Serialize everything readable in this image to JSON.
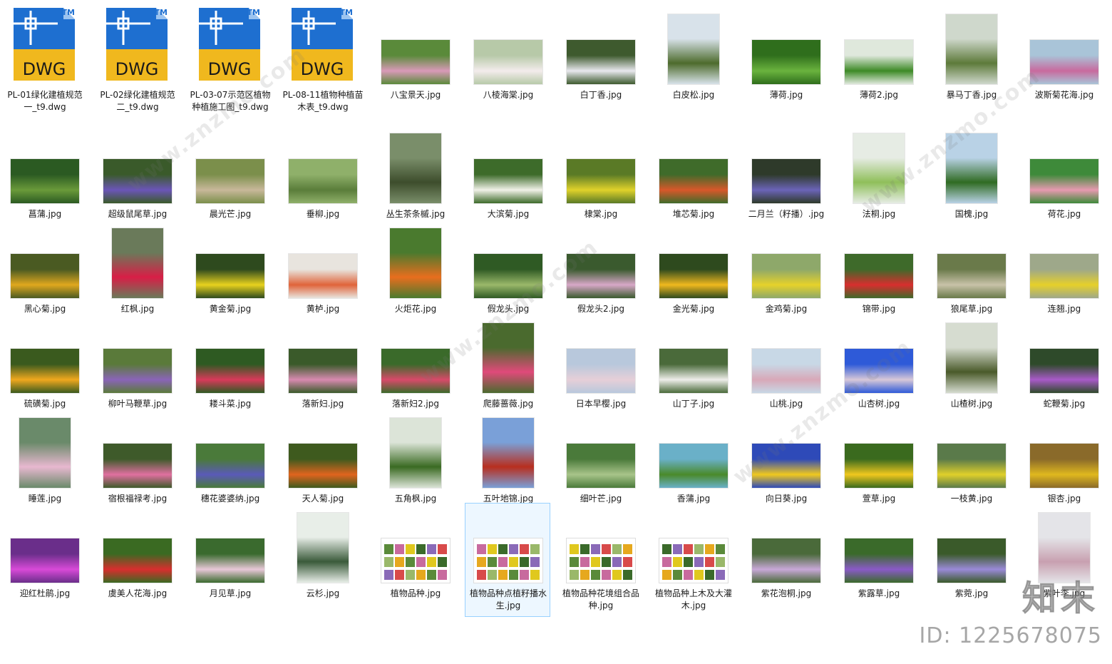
{
  "files": [
    {
      "name": "PL-01绿化建植规范一_t9.dwg",
      "type": "dwg"
    },
    {
      "name": "PL-02绿化建植规范二_t9.dwg",
      "type": "dwg"
    },
    {
      "name": "PL-03-07示范区植物种植施工图_t9.dwg",
      "type": "dwg"
    },
    {
      "name": "PL-08-11植物种植苗木表_t9.dwg",
      "type": "dwg"
    },
    {
      "name": "八宝景天.jpg",
      "type": "photo",
      "colors": [
        "#5a8a3a",
        "#d99ab8"
      ]
    },
    {
      "name": "八棱海棠.jpg",
      "type": "photo",
      "colors": [
        "#b7c9a8",
        "#f3ecec"
      ]
    },
    {
      "name": "白丁香.jpg",
      "type": "photo",
      "colors": [
        "#3e5a2e",
        "#e8e8ee"
      ]
    },
    {
      "name": "白皮松.jpg",
      "type": "tall",
      "colors": [
        "#d8e2ea",
        "#4d6b2c"
      ]
    },
    {
      "name": "薄荷.jpg",
      "type": "photo",
      "colors": [
        "#2f6e1c",
        "#6ab33e"
      ]
    },
    {
      "name": "薄荷2.jpg",
      "type": "photo",
      "colors": [
        "#dfe8dc",
        "#3d8a26"
      ]
    },
    {
      "name": "暴马丁香.jpg",
      "type": "tall",
      "colors": [
        "#cfd8cc",
        "#5d7a3a"
      ]
    },
    {
      "name": "波斯菊花海.jpg",
      "type": "photo",
      "colors": [
        "#a9c4d8",
        "#c86a9e"
      ]
    },
    {
      "name": "菖蒲.jpg",
      "type": "photo",
      "colors": [
        "#2b5a22",
        "#6a9a3a"
      ]
    },
    {
      "name": "超级鼠尾草.jpg",
      "type": "photo",
      "colors": [
        "#3a5a2a",
        "#6b55b8"
      ]
    },
    {
      "name": "晨光芒.jpg",
      "type": "photo",
      "colors": [
        "#7b8f4b",
        "#c8b89a"
      ]
    },
    {
      "name": "垂柳.jpg",
      "type": "photo",
      "colors": [
        "#8fb06a",
        "#5a7d3a"
      ]
    },
    {
      "name": "丛生茶条槭.jpg",
      "type": "tall",
      "colors": [
        "#7a8e6a",
        "#3d4d2c"
      ]
    },
    {
      "name": "大滨菊.jpg",
      "type": "photo",
      "colors": [
        "#3d6b2a",
        "#f1f1e8"
      ]
    },
    {
      "name": "棣棠.jpg",
      "type": "photo",
      "colors": [
        "#5a7a26",
        "#e0d22a"
      ]
    },
    {
      "name": "堆芯菊.jpg",
      "type": "photo",
      "colors": [
        "#3f6b2a",
        "#d8582a"
      ]
    },
    {
      "name": "二月兰（籽播）.jpg",
      "type": "photo",
      "colors": [
        "#2e3a2a",
        "#6b64b8"
      ]
    },
    {
      "name": "法桐.jpg",
      "type": "tall",
      "colors": [
        "#e6ece4",
        "#8fbf5a"
      ]
    },
    {
      "name": "国槐.jpg",
      "type": "tall",
      "colors": [
        "#b9d2e6",
        "#2f6b22"
      ]
    },
    {
      "name": "荷花.jpg",
      "type": "photo",
      "colors": [
        "#3e8a3a",
        "#e79ab0"
      ]
    },
    {
      "name": "黑心菊.jpg",
      "type": "photo",
      "colors": [
        "#4a5a22",
        "#e0a81e"
      ]
    },
    {
      "name": "红枫.jpg",
      "type": "tall",
      "colors": [
        "#6a7a5a",
        "#d81e46"
      ]
    },
    {
      "name": "黄金菊.jpg",
      "type": "photo",
      "colors": [
        "#2e4a1e",
        "#e8d21e"
      ]
    },
    {
      "name": "黄栌.jpg",
      "type": "photo",
      "colors": [
        "#e8e4de",
        "#e0643a"
      ]
    },
    {
      "name": "火炬花.jpg",
      "type": "tall",
      "colors": [
        "#4a7a2e",
        "#e86e1e"
      ]
    },
    {
      "name": "假龙头.jpg",
      "type": "photo",
      "colors": [
        "#2f5a24",
        "#9ab86a"
      ]
    },
    {
      "name": "假龙头2.jpg",
      "type": "photo",
      "colors": [
        "#3a5a2e",
        "#d8a8c8"
      ]
    },
    {
      "name": "金光菊.jpg",
      "type": "photo",
      "colors": [
        "#2e4a1e",
        "#f0b81e"
      ]
    },
    {
      "name": "金鸡菊.jpg",
      "type": "photo",
      "colors": [
        "#8ea86a",
        "#e6d22a"
      ]
    },
    {
      "name": "锦带.jpg",
      "type": "photo",
      "colors": [
        "#3e6a2a",
        "#d82e2e"
      ]
    },
    {
      "name": "狼尾草.jpg",
      "type": "photo",
      "colors": [
        "#6a7a4a",
        "#c8c2a8"
      ]
    },
    {
      "name": "连翘.jpg",
      "type": "photo",
      "colors": [
        "#9ea88a",
        "#e6d02a"
      ]
    },
    {
      "name": "硫磺菊.jpg",
      "type": "photo",
      "colors": [
        "#3a5a1e",
        "#f0a81e"
      ]
    },
    {
      "name": "柳叶马鞭草.jpg",
      "type": "photo",
      "colors": [
        "#5a7a3a",
        "#8a64b8"
      ]
    },
    {
      "name": "耧斗菜.jpg",
      "type": "photo",
      "colors": [
        "#2e5a22",
        "#d83a5a"
      ]
    },
    {
      "name": "落新妇.jpg",
      "type": "photo",
      "colors": [
        "#3a5a2a",
        "#d88ab0"
      ]
    },
    {
      "name": "落新妇2.jpg",
      "type": "photo",
      "colors": [
        "#3a6a2a",
        "#d84a6a"
      ]
    },
    {
      "name": "爬藤蔷薇.jpg",
      "type": "tall",
      "colors": [
        "#4a6a2e",
        "#e04a7a"
      ]
    },
    {
      "name": "日本早樱.jpg",
      "type": "photo",
      "colors": [
        "#b8c8dc",
        "#e6cfd8"
      ]
    },
    {
      "name": "山丁子.jpg",
      "type": "photo",
      "colors": [
        "#4a6a3a",
        "#eeeeea"
      ]
    },
    {
      "name": "山桃.jpg",
      "type": "photo",
      "colors": [
        "#c8d8e6",
        "#d8a8b8"
      ]
    },
    {
      "name": "山杏树.jpg",
      "type": "photo",
      "colors": [
        "#2e5ad8",
        "#d8c8d8"
      ]
    },
    {
      "name": "山楂树.jpg",
      "type": "tall",
      "colors": [
        "#d6dcd0",
        "#4a5a2a"
      ]
    },
    {
      "name": "蛇鞭菊.jpg",
      "type": "photo",
      "colors": [
        "#2e4a2a",
        "#a85ac8"
      ]
    },
    {
      "name": "睡莲.jpg",
      "type": "tall",
      "colors": [
        "#6a8a6a",
        "#e8b8d0"
      ]
    },
    {
      "name": "宿根福禄考.jpg",
      "type": "photo",
      "colors": [
        "#3e5a2a",
        "#e070a0"
      ]
    },
    {
      "name": "穗花婆婆纳.jpg",
      "type": "photo",
      "colors": [
        "#4a7a3a",
        "#5a5ab8"
      ]
    },
    {
      "name": "天人菊.jpg",
      "type": "photo",
      "colors": [
        "#3e5a1e",
        "#e0641e"
      ]
    },
    {
      "name": "五角枫.jpg",
      "type": "tall",
      "colors": [
        "#dce4d8",
        "#3a6a22"
      ]
    },
    {
      "name": "五叶地锦.jpg",
      "type": "tall",
      "colors": [
        "#7aa0d8",
        "#b82e1e"
      ]
    },
    {
      "name": "细叶芒.jpg",
      "type": "photo",
      "colors": [
        "#4a7a3a",
        "#a8c48a"
      ]
    },
    {
      "name": "香蒲.jpg",
      "type": "photo",
      "colors": [
        "#6ab0c8",
        "#4a8a2a"
      ]
    },
    {
      "name": "向日葵.jpg",
      "type": "photo",
      "colors": [
        "#2e4ab8",
        "#f0c81e"
      ]
    },
    {
      "name": "萱草.jpg",
      "type": "photo",
      "colors": [
        "#3a6a1e",
        "#f0c81e"
      ]
    },
    {
      "name": "一枝黄.jpg",
      "type": "photo",
      "colors": [
        "#5a7a4a",
        "#e0d02a"
      ]
    },
    {
      "name": "银杏.jpg",
      "type": "photo",
      "colors": [
        "#8a6a2a",
        "#e0b81e"
      ]
    },
    {
      "name": "迎红杜鹃.jpg",
      "type": "photo",
      "colors": [
        "#6a2e8a",
        "#d84ad8"
      ]
    },
    {
      "name": "虞美人花海.jpg",
      "type": "photo",
      "colors": [
        "#3a6a22",
        "#d82e2e"
      ]
    },
    {
      "name": "月见草.jpg",
      "type": "photo",
      "colors": [
        "#3a6a2e",
        "#e8c8d8"
      ]
    },
    {
      "name": "云杉.jpg",
      "type": "tall",
      "colors": [
        "#e8eee8",
        "#3a5a3a"
      ]
    },
    {
      "name": "植物品种.jpg",
      "type": "doc"
    },
    {
      "name": "植物品种点植籽播水生.jpg",
      "type": "doc",
      "selected": true
    },
    {
      "name": "植物品种花境组合品种.jpg",
      "type": "doc"
    },
    {
      "name": "植物品种上木及大灌木.jpg",
      "type": "doc"
    },
    {
      "name": "紫花泡桐.jpg",
      "type": "photo",
      "colors": [
        "#4a6a3a",
        "#c8a8d8"
      ]
    },
    {
      "name": "紫露草.jpg",
      "type": "photo",
      "colors": [
        "#3a6a2a",
        "#8a5ac8"
      ]
    },
    {
      "name": "紫菀.jpg",
      "type": "photo",
      "colors": [
        "#3a5a2a",
        "#9a8ad8"
      ]
    },
    {
      "name": "紫叶李.jpg",
      "type": "tall",
      "colors": [
        "#e4e4e8",
        "#c8a0b0"
      ]
    }
  ],
  "watermark": {
    "brand": "知末",
    "id": "ID: 1225678075",
    "site": "www.znzmo.com"
  },
  "dwg_icon": {
    "badge": "DWG",
    "tm": "TM",
    "blue": "#1e6fd0",
    "yellow": "#f0b81e"
  }
}
